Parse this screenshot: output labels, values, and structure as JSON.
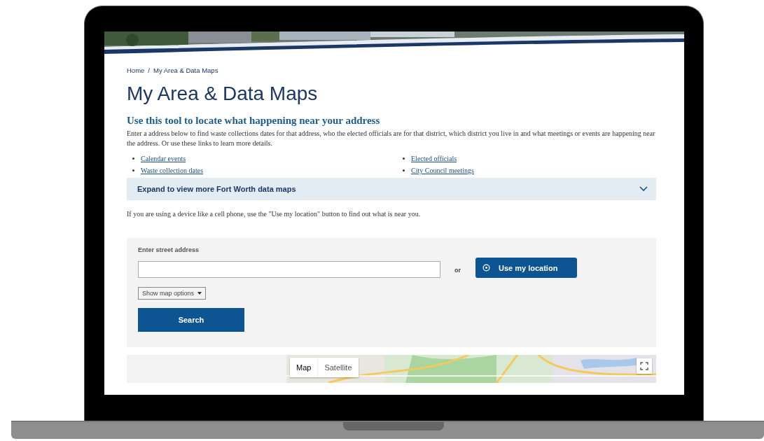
{
  "breadcrumb": {
    "items": [
      "Home",
      "My Area & Data Maps"
    ],
    "separator": "/"
  },
  "title": "My Area & Data Maps",
  "subtitle": "Use this tool to locate what happening near your address",
  "intro": "Enter a address below to find waste collections dates for that address, who the elected officials are for that district, which district you live in and what meetings or events are happening near the address. Or use these links to learn more details.",
  "links": [
    "Calendar events",
    "Waste collection dates",
    "Elected officials",
    "City Council meetings"
  ],
  "accordion": {
    "label": "Expand to view more Fort Worth data maps",
    "expanded": false
  },
  "note": "If you are using a device like a cell phone, use the \"Use my location\" button to find out what is near you.",
  "form": {
    "label": "Enter street address",
    "or_text": "or",
    "location_button": "Use my location",
    "map_options": "Show map options",
    "search_button": "Search"
  },
  "map": {
    "map_types": [
      {
        "label": "Map",
        "selected": true
      },
      {
        "label": "Satellite",
        "selected": false
      }
    ]
  }
}
